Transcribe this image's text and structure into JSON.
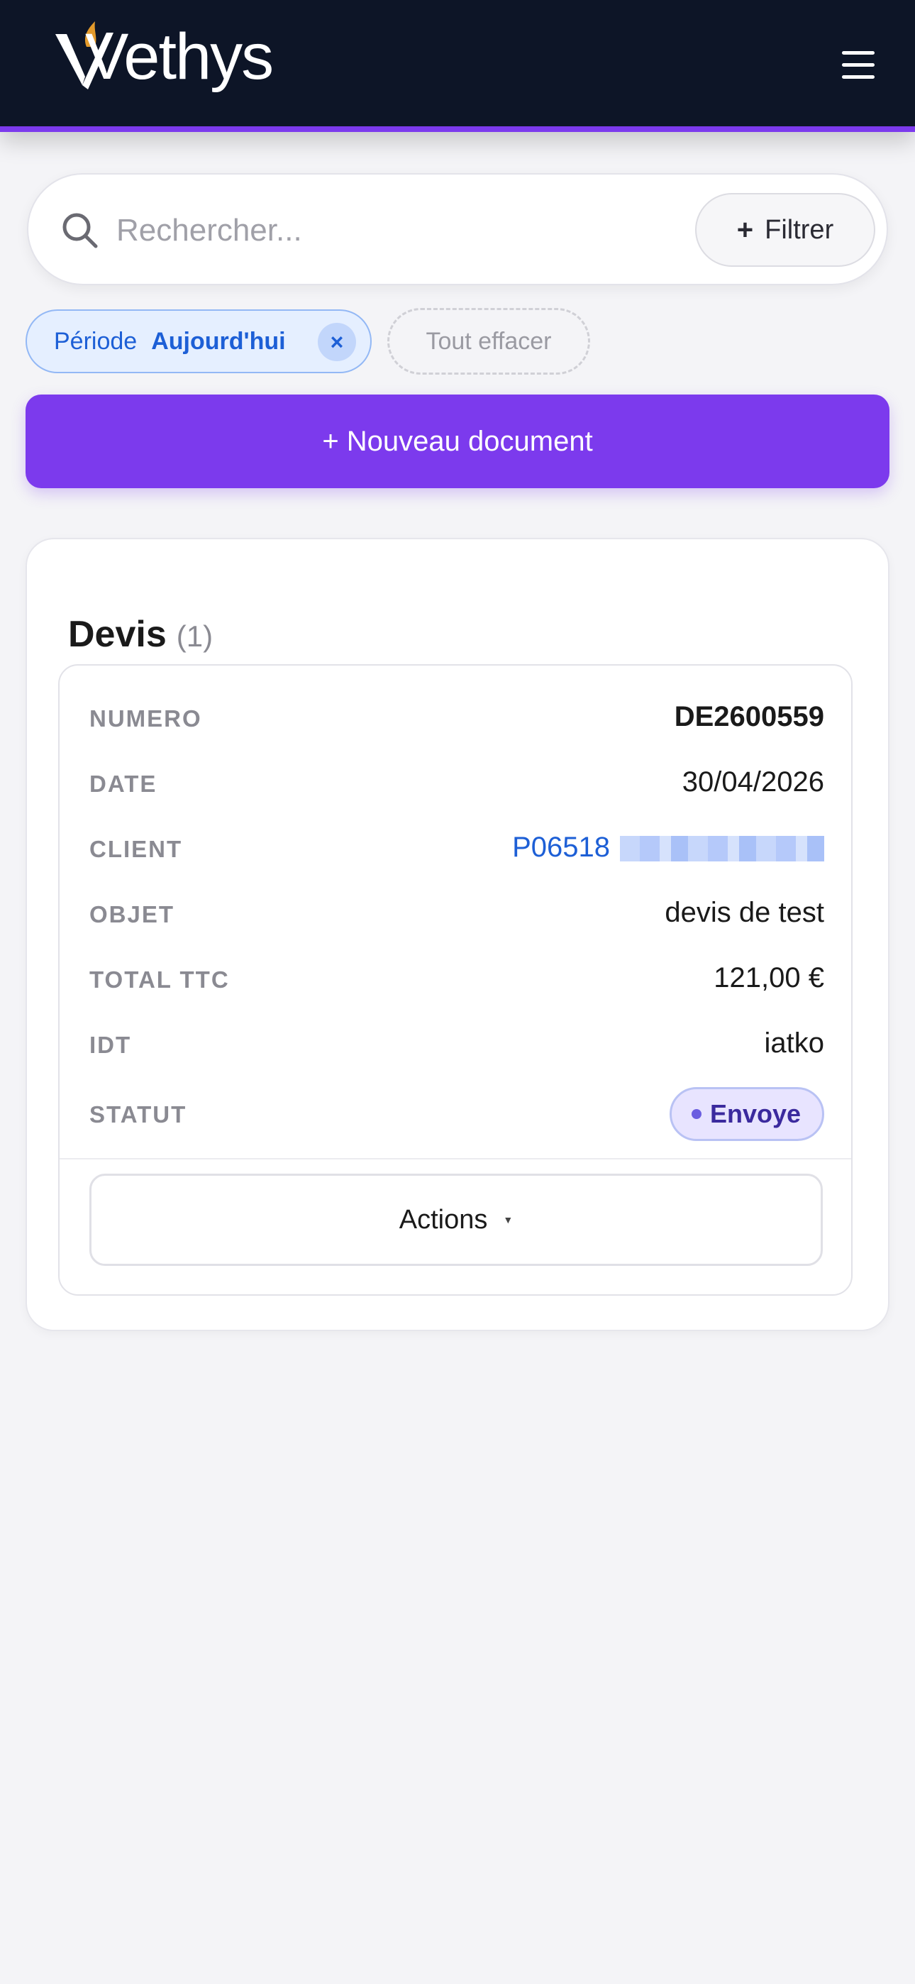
{
  "header": {
    "brand": "Vethys",
    "menu_icon": "hamburger-menu-icon"
  },
  "search": {
    "placeholder": "Rechercher...",
    "icon": "search-icon",
    "filter_label": "Filtrer"
  },
  "filters": {
    "active_chip": {
      "key": "Période",
      "value": "Aujourd'hui"
    },
    "clear_all_label": "Tout effacer"
  },
  "new_document_label": "+ Nouveau document",
  "section": {
    "title": "Devis",
    "count": "(1)"
  },
  "document": {
    "fields": [
      {
        "label": "NUMERO",
        "value": "DE2600559"
      },
      {
        "label": "DATE",
        "value": "30/04/2026"
      },
      {
        "label": "CLIENT",
        "value": "P06518"
      },
      {
        "label": "OBJET",
        "value": "devis de test"
      },
      {
        "label": "TOTAL TTC",
        "value": "121,00 €"
      },
      {
        "label": "IDT",
        "value": "iatko"
      },
      {
        "label": "STATUT",
        "value": "Envoye"
      }
    ],
    "actions_label": "Actions"
  },
  "colors": {
    "header_bg": "#0d1527",
    "accent": "#7c3aed",
    "link": "#1d5fd6",
    "status_text": "#3b2a9e"
  }
}
